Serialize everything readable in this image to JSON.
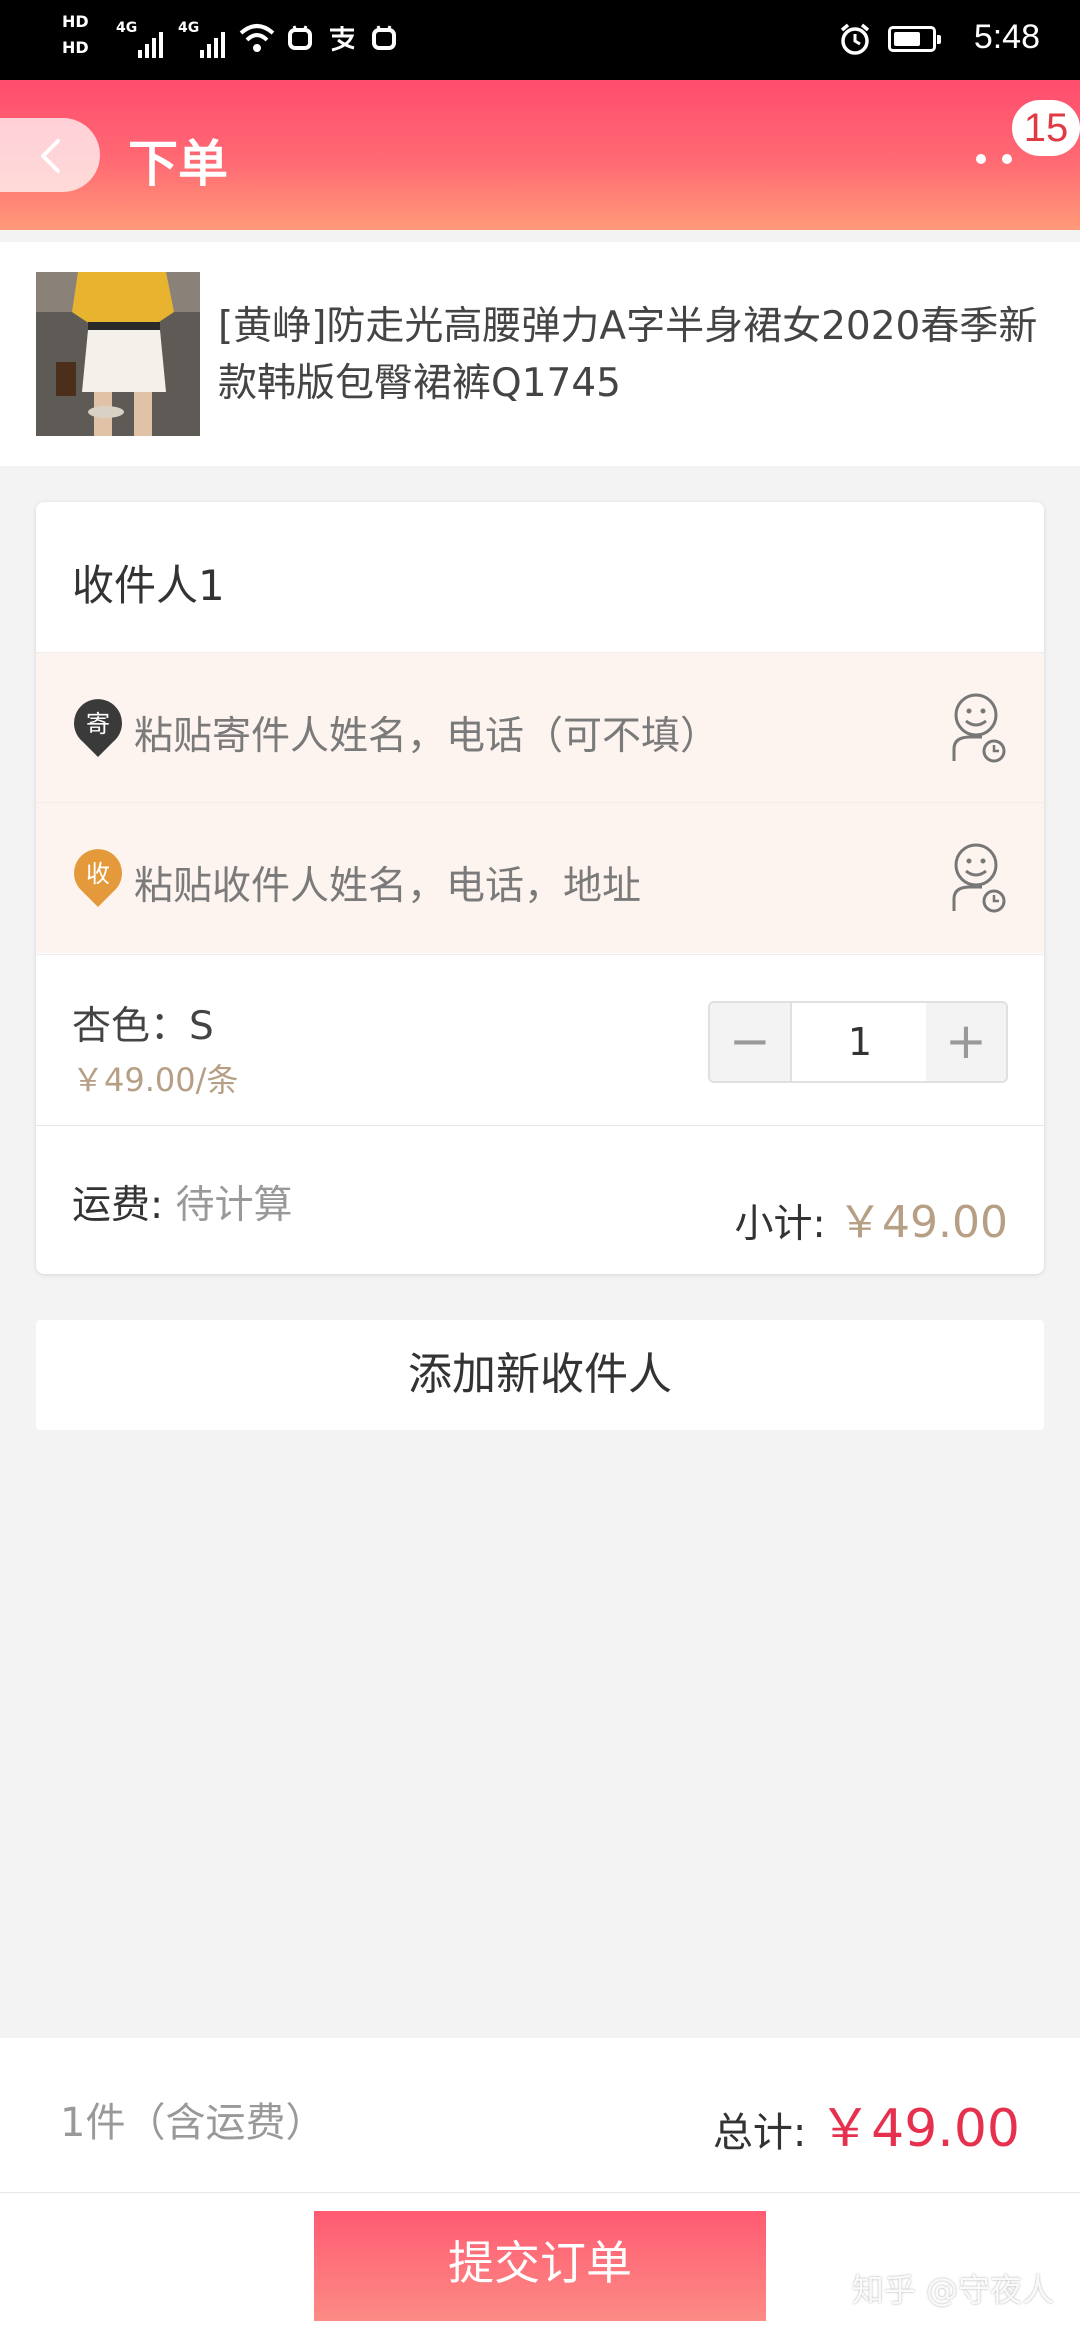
{
  "status_bar": {
    "hd1": "HD",
    "hd2": "HD",
    "net1": "4G",
    "net2": "4G",
    "time": "5:48",
    "icons": [
      "wifi-icon",
      "alarm-icon",
      "battery-icon"
    ]
  },
  "header": {
    "title": "下单",
    "badge": "15",
    "background_gradient": [
      "#ff4d6e",
      "#ff9a78"
    ]
  },
  "product": {
    "title": "[黄峥]防走光高腰弹力A字半身裙女2020春季新款韩版包臀裙裤Q1745"
  },
  "recipient_card": {
    "title": "收件人1",
    "sender_pin": "寄",
    "sender_placeholder": "粘贴寄件人姓名，电话（可不填）",
    "receiver_pin": "收",
    "receiver_placeholder": "粘贴收件人姓名，电话，地址",
    "variant": "杏色：S",
    "unit_price": "￥49.00/条",
    "quantity": "1",
    "minus": "−",
    "plus": "+",
    "shipping_label": "运费:",
    "shipping_value": "待计算",
    "subtotal_label": "小计:",
    "subtotal_value": "￥49.00"
  },
  "add_recipient_label": "添加新收件人",
  "summary": {
    "count": "1件（含运费）",
    "total_label": "总计:",
    "total_value": "￥49.00"
  },
  "submit_label": "提交订单",
  "watermark": "知乎 @守夜人",
  "colors": {
    "accent": "#e5304e",
    "price_muted": "#b79f85",
    "sender_pin": "#3a3a3a",
    "receiver_pin": "#e49a3a"
  }
}
